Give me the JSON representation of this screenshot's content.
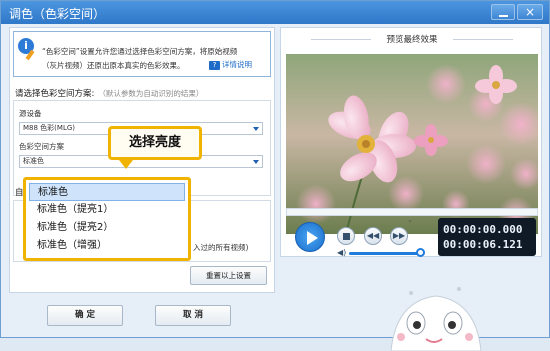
{
  "window": {
    "title": "调色（色彩空间）",
    "close_label": "×"
  },
  "info": {
    "line1": "“色彩空间”设置允许您通过选择色彩空间方案，将原始视频",
    "line2": "（灰片视频）还原出原本真实的色彩效果。",
    "help_label": "详情说明",
    "help_icon": "?"
  },
  "color_space": {
    "section_title": "请选择色彩空间方案:",
    "hint": "（默认参数为自动识别的结果）",
    "source_label": "源设备",
    "source_value": "M88 色彩(MLG)",
    "scheme_label": "色彩空间方案",
    "scheme_value": "标准色"
  },
  "group2": {
    "title": "自",
    "tail_text": "入过的所有视频)"
  },
  "callout": {
    "label": "选择亮度",
    "color": "#f0b400"
  },
  "dropdown": {
    "options": [
      "标准色",
      "标准色（提亮1）",
      "标准色（提亮2）",
      "标准色（增强）"
    ],
    "selected_index": 0
  },
  "buttons": {
    "reset": "重置以上设置",
    "ok": "确 定",
    "cancel": "取 消"
  },
  "preview": {
    "title": "预览最终效果",
    "time_current": "00:00:00.000",
    "time_total": "00:00:06.121",
    "volume_level": 0.92,
    "prev_icon": "◀◀",
    "next_icon": "▶▶",
    "volume_icon": "◀)"
  },
  "colors": {
    "titlebar": "#3a86d6",
    "accent": "#1f7bdc",
    "highlight": "#f0b400"
  }
}
